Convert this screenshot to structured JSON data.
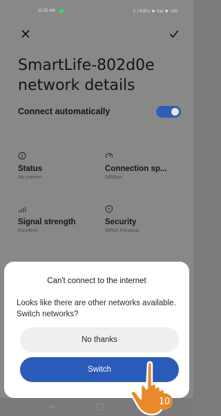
{
  "status_bar": {
    "time": "11:35 AM",
    "right": "2.7KB/s ✱ 5al ✱ 100"
  },
  "toolbar": {
    "close_icon": "close-icon",
    "confirm_icon": "check-icon"
  },
  "page": {
    "title": "SmartLife-802d0e network details"
  },
  "auto_connect": {
    "label": "Connect automatically",
    "enabled": true,
    "accent": "#2f5fb5"
  },
  "details": [
    {
      "icon": "info-icon",
      "title": "Status",
      "value": "No internet"
    },
    {
      "icon": "speed-icon",
      "title": "Connection sp...",
      "value": "54Mbps"
    },
    {
      "icon": "signal-icon",
      "title": "Signal strength",
      "value": "Excellent"
    },
    {
      "icon": "shield-icon",
      "title": "Security",
      "value": "WPA2-Personal"
    }
  ],
  "dialog": {
    "title": "Can't connect to the internet",
    "message": "Looks like there are other networks available. Switch networks?",
    "secondary_button": "No thanks",
    "primary_button": "Switch",
    "primary_color": "#2a5bb8"
  },
  "annotation": {
    "step": "10",
    "color": "#e88a2b"
  }
}
